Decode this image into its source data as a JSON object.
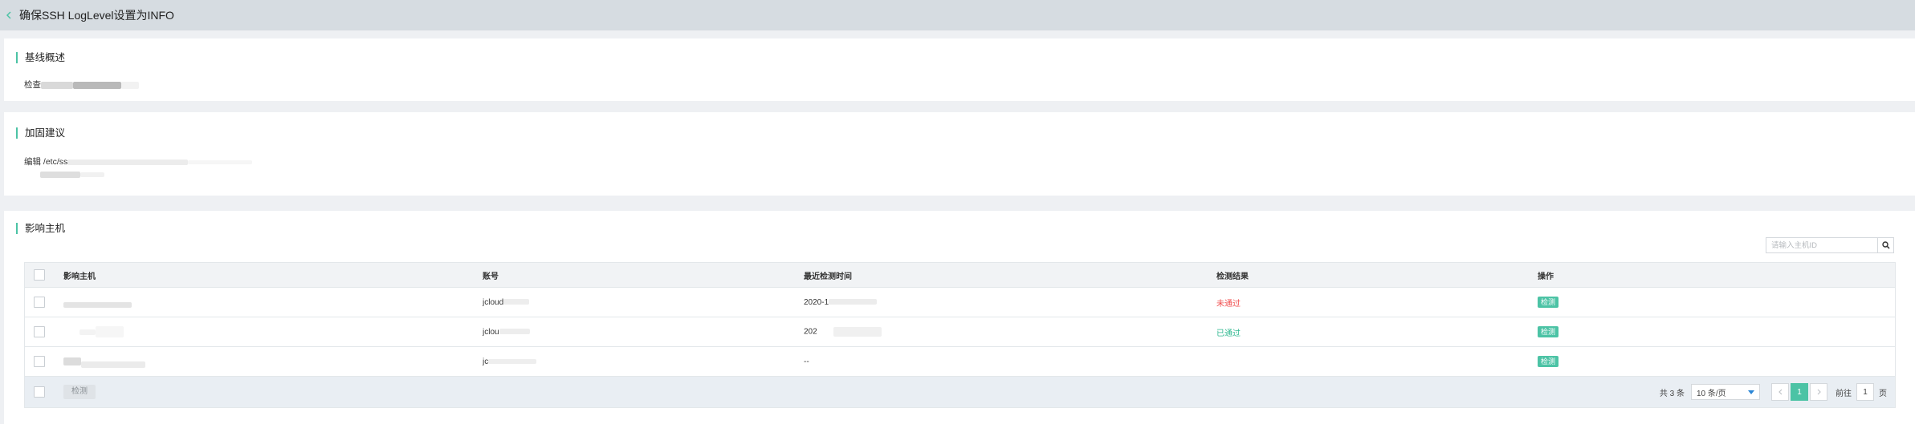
{
  "header": {
    "title": "确保SSH LogLevel设置为INFO"
  },
  "overview": {
    "title": "基线概述",
    "text_start": "检查",
    "text_end": ""
  },
  "advice": {
    "title": "加固建议",
    "text": "编辑 /etc/ss"
  },
  "hosts": {
    "title": "影响主机",
    "search_placeholder": "请输入主机ID",
    "columns": {
      "host": "影响主机",
      "account": "账号",
      "time": "最近检测时间",
      "result": "检测结果",
      "action": "操作"
    },
    "rows": [
      {
        "account": "jcloud",
        "time": "2020-1",
        "result": "未通过",
        "result_status": "fail",
        "action": "检测"
      },
      {
        "account": "jclou",
        "time": "202",
        "result": "已通过",
        "result_status": "pass",
        "action": "检测"
      },
      {
        "account": "jc",
        "time": "--",
        "result": "",
        "result_status": "",
        "action": "检测"
      }
    ],
    "footer": {
      "batch_button": "检测",
      "total": "共 3 条",
      "page_size": "10 条/页",
      "current_page": "1",
      "goto_label": "前往",
      "goto_value": "1",
      "page_suffix": "页"
    }
  },
  "colors": {
    "accent": "#4cc3a5",
    "fail": "#f04c4c",
    "pass": "#2fb88f"
  }
}
